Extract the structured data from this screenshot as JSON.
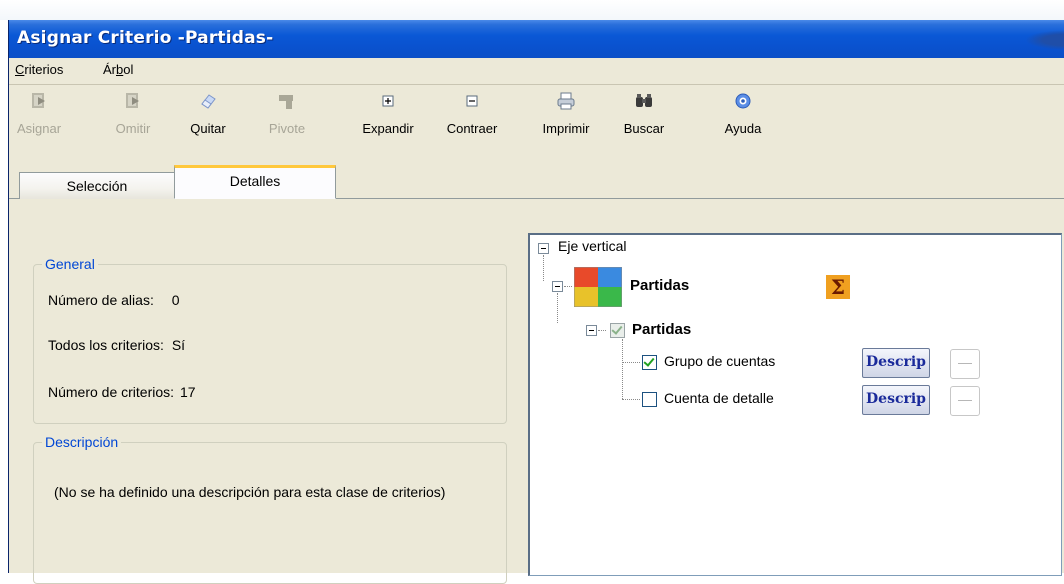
{
  "window": {
    "title": "Asignar Criterio -Partidas-"
  },
  "menu": {
    "items": [
      {
        "prefix": "",
        "accel": "C",
        "rest": "riterios"
      },
      {
        "prefix": "Ár",
        "accel": "b",
        "rest": "ol"
      }
    ]
  },
  "toolbar": {
    "buttons": [
      {
        "label": "Asignar",
        "icon": "assign-icon",
        "enabled": false
      },
      {
        "label": "Omitir",
        "icon": "skip-icon",
        "enabled": false
      },
      {
        "label": "Quitar",
        "icon": "eraser-icon",
        "enabled": true
      },
      {
        "label": "Pivote",
        "icon": "pivot-icon",
        "enabled": false
      },
      {
        "label": "Expandir",
        "icon": "expand-icon",
        "enabled": true
      },
      {
        "label": "Contraer",
        "icon": "collapse-icon",
        "enabled": true
      },
      {
        "label": "Imprimir",
        "icon": "printer-icon",
        "enabled": true
      },
      {
        "label": "Buscar",
        "icon": "binoculars-icon",
        "enabled": true
      },
      {
        "label": "Ayuda",
        "icon": "help-icon",
        "enabled": true
      }
    ]
  },
  "tabs": [
    {
      "label": "Selección",
      "active": false
    },
    {
      "label": "Detalles",
      "active": true
    }
  ],
  "general": {
    "legend": "General",
    "alias_label": "Número de alias:",
    "alias_value": "0",
    "todos_label": "Todos los criterios:",
    "todos_value": "Sí",
    "numcrit_label": "Número de criterios:",
    "numcrit_value": "17"
  },
  "descripcion": {
    "legend": "Descripción",
    "text": "(No se ha definido una descripción para esta clase de criterios)"
  },
  "tree": {
    "root": "Eje vertical",
    "dimension": "Partidas",
    "group": "Partidas",
    "items": [
      {
        "label": "Grupo de cuentas",
        "checked": true,
        "button": "Descrip"
      },
      {
        "label": "Cuenta de detalle",
        "checked": false,
        "button": "Descrip"
      }
    ],
    "sigma": "Σ"
  },
  "colors": {
    "titlebar": "#0a52cf",
    "accent_legend": "#0046d5",
    "tab_highlight": "#ffc83c",
    "window_bg": "#ece9d8"
  }
}
